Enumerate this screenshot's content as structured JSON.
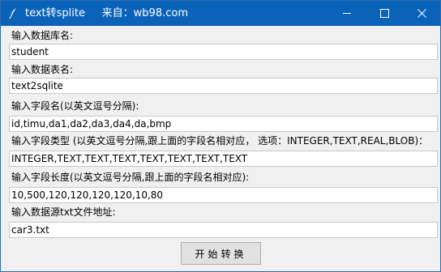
{
  "window": {
    "title": "text转splite     来自：wb98.com",
    "icon": "feather-icon",
    "controls": [
      "minimize-icon",
      "maximize-icon",
      "close-icon"
    ]
  },
  "form": {
    "fields": [
      {
        "label": "输入数据库名:",
        "value": "student"
      },
      {
        "label": "输入数据表名:",
        "value": "text2sqlite"
      },
      {
        "label": "输入字段名(以英文逗号分隔):",
        "value": "id,timu,da1,da2,da3,da4,da,bmp"
      },
      {
        "label": "输入字段类型 (以英文逗号分隔,跟上面的字段名相对应，  选项：INTEGER,TEXT,REAL,BLOB)：",
        "value": "INTEGER,TEXT,TEXT,TEXT,TEXT,TEXT,TEXT,TEXT"
      },
      {
        "label": "输入字段长度(以英文逗号分隔,跟上面的字段名相对应):",
        "value": "10,500,120,120,120,120,10,80"
      },
      {
        "label": "输入数据源txt文件地址:",
        "value": "car3.txt"
      }
    ],
    "start_label": "开始转换"
  }
}
